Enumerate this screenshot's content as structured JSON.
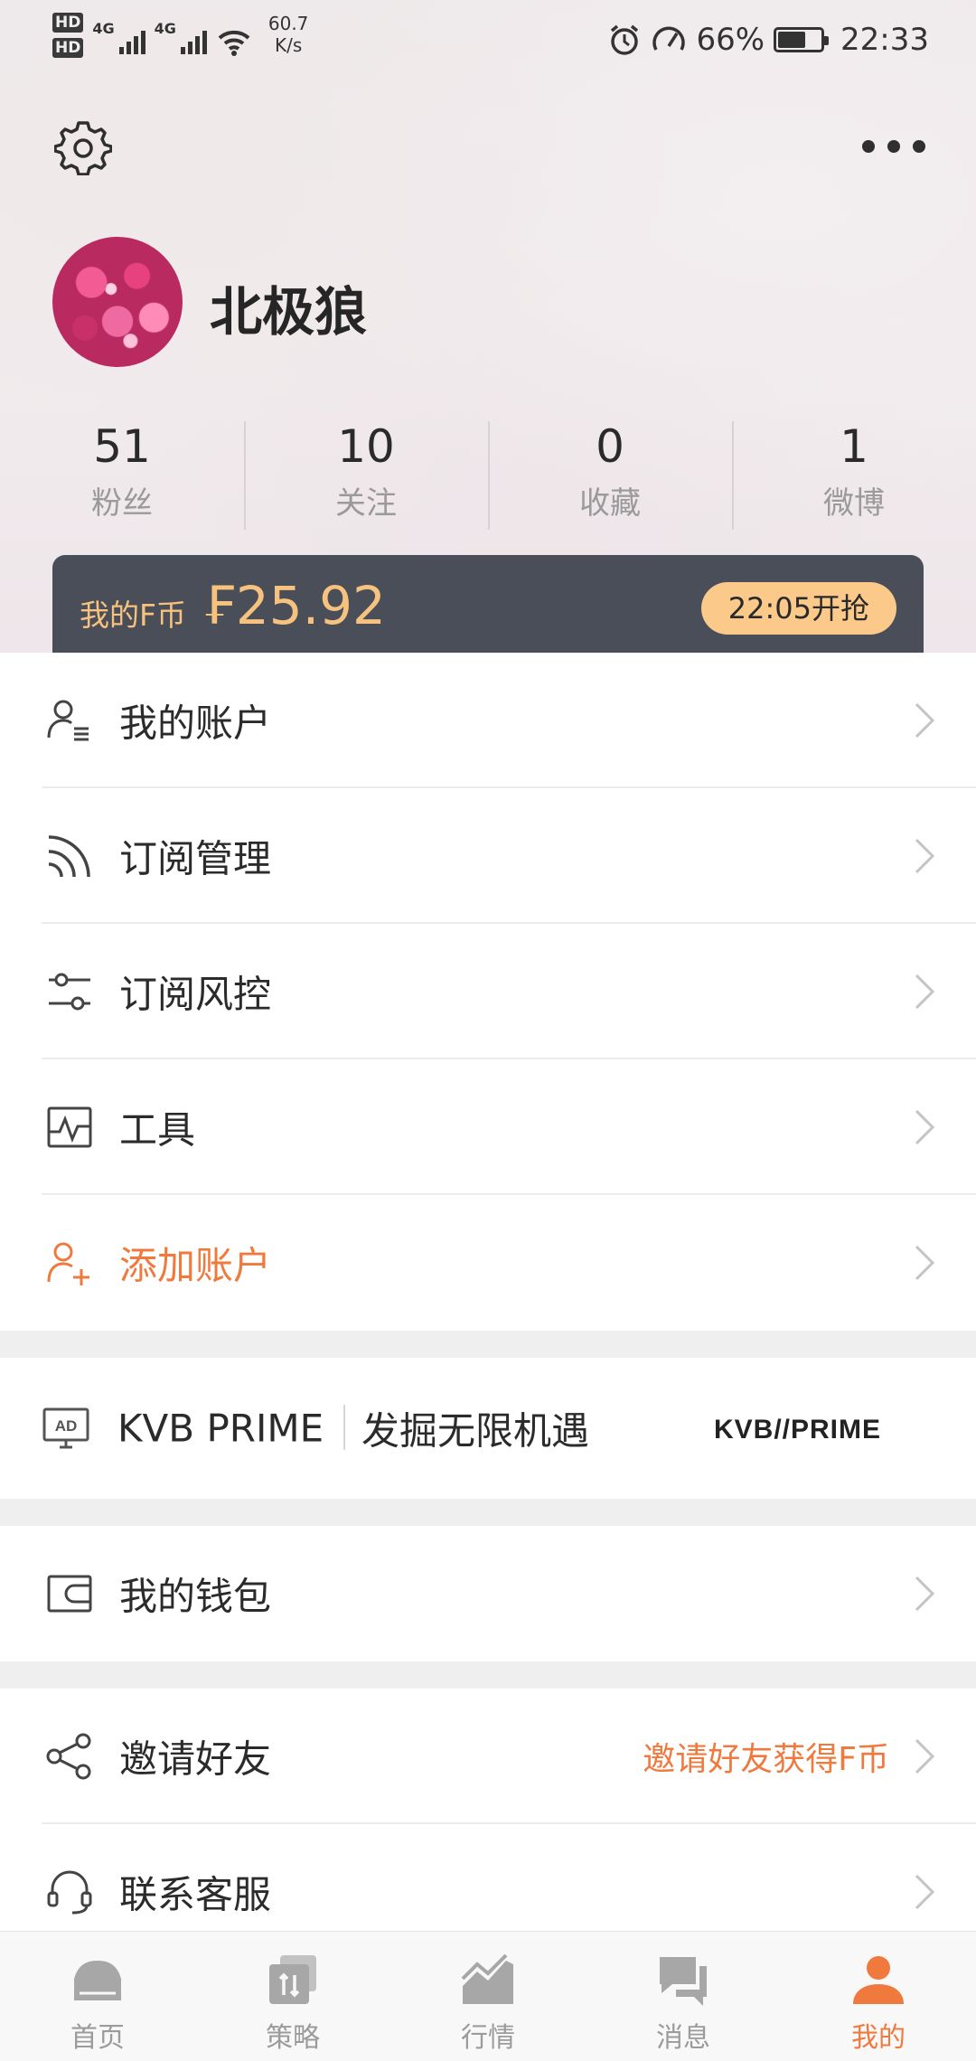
{
  "status_bar": {
    "hd1": "HD",
    "hd2": "HD",
    "sim1": "4G",
    "sim2": "4G",
    "speed_value": "60.7",
    "speed_unit": "K/s",
    "battery": "66%",
    "battery_level": 0.66,
    "time": "22:33"
  },
  "header": {
    "settings_icon": "gear-icon",
    "more_icon": "more-dots-icon"
  },
  "profile": {
    "username": "北极狼",
    "avatar": "pink-flower-avatar"
  },
  "stats": [
    {
      "value": "51",
      "label": "粉丝"
    },
    {
      "value": "10",
      "label": "关注"
    },
    {
      "value": "0",
      "label": "收藏"
    },
    {
      "value": "1",
      "label": "微博"
    }
  ],
  "coin_card": {
    "label": "我的F币",
    "value": "₣25.92",
    "button": "22:05开抢"
  },
  "menu_group1": [
    {
      "label": "我的账户",
      "icon": "account-list-icon"
    },
    {
      "label": "订阅管理",
      "icon": "rss-icon"
    },
    {
      "label": "订阅风控",
      "icon": "sliders-icon"
    },
    {
      "label": "工具",
      "icon": "chart-tool-icon"
    },
    {
      "label": "添加账户",
      "icon": "add-user-icon"
    }
  ],
  "ad": {
    "brand": "KVB PRIME",
    "slogan": "发掘无限机遇",
    "logo_text": "KVB//PRIME"
  },
  "wallet": {
    "label": "我的钱包",
    "icon": "wallet-icon"
  },
  "menu_group3": [
    {
      "label": "邀请好友",
      "right_text": "邀请好友获得F币",
      "icon": "share-icon"
    },
    {
      "label": "联系客服",
      "icon": "headset-icon"
    }
  ],
  "tabs": [
    {
      "label": "首页",
      "icon": "home-icon"
    },
    {
      "label": "策略",
      "icon": "strategy-icon"
    },
    {
      "label": "行情",
      "icon": "market-chart-icon"
    },
    {
      "label": "消息",
      "icon": "message-icon"
    },
    {
      "label": "我的",
      "icon": "profile-icon"
    }
  ],
  "colors": {
    "accent": "#f07a3e",
    "coin_gold": "#f6c27d",
    "card_dark": "#4a4e59"
  }
}
